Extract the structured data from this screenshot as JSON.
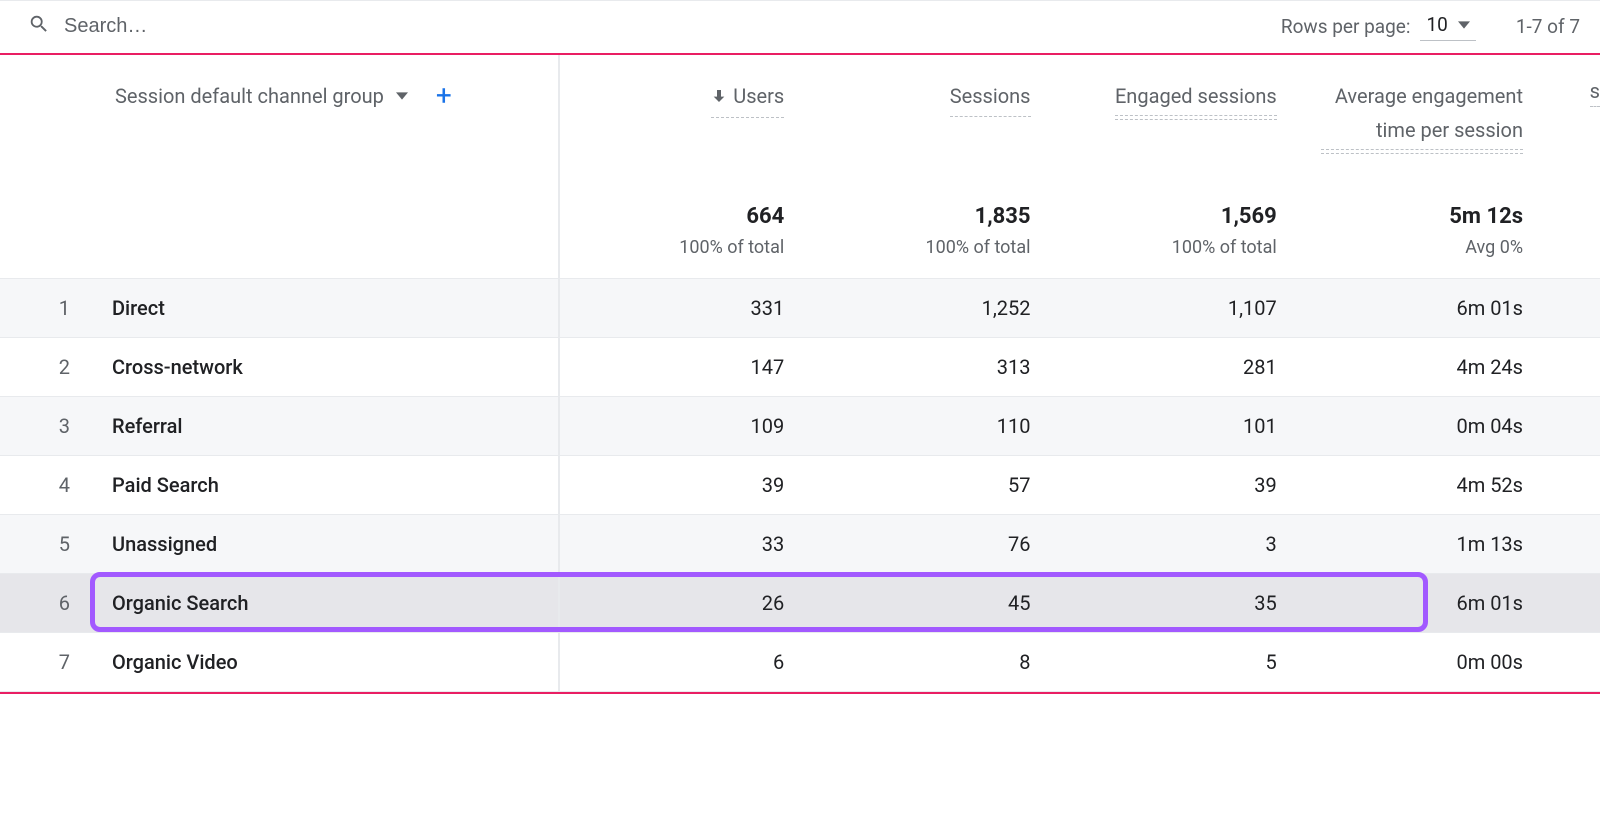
{
  "search": {
    "placeholder": "Search…"
  },
  "pager": {
    "rows_label": "Rows per page:",
    "rows_value": "10",
    "range": "1-7 of 7"
  },
  "dimension": {
    "label": "Session default channel group"
  },
  "columns": [
    {
      "label": "Users",
      "sorted": true,
      "total": "664",
      "sub": "100% of total"
    },
    {
      "label": "Sessions",
      "sorted": false,
      "total": "1,835",
      "sub": "100% of total"
    },
    {
      "label": "Engaged sessions",
      "sorted": false,
      "total": "1,569",
      "sub": "100% of total"
    },
    {
      "label": "Average engagement time per session",
      "sorted": false,
      "total": "5m 12s",
      "sub": "Avg 0%"
    }
  ],
  "extra_col_fragment": "s",
  "rows": [
    {
      "idx": "1",
      "name": "Direct",
      "v": [
        "331",
        "1,252",
        "1,107",
        "6m 01s"
      ]
    },
    {
      "idx": "2",
      "name": "Cross-network",
      "v": [
        "147",
        "313",
        "281",
        "4m 24s"
      ]
    },
    {
      "idx": "3",
      "name": "Referral",
      "v": [
        "109",
        "110",
        "101",
        "0m 04s"
      ]
    },
    {
      "idx": "4",
      "name": "Paid Search",
      "v": [
        "39",
        "57",
        "39",
        "4m 52s"
      ]
    },
    {
      "idx": "5",
      "name": "Unassigned",
      "v": [
        "33",
        "76",
        "3",
        "1m 13s"
      ]
    },
    {
      "idx": "6",
      "name": "Organic Search",
      "v": [
        "26",
        "45",
        "35",
        "6m 01s"
      ],
      "highlight": true
    },
    {
      "idx": "7",
      "name": "Organic Video",
      "v": [
        "6",
        "8",
        "5",
        "0m 00s"
      ]
    }
  ],
  "chart_data": {
    "type": "table",
    "title": "Session default channel group",
    "columns": [
      "Users",
      "Sessions",
      "Engaged sessions",
      "Average engagement time per session"
    ],
    "categories": [
      "Direct",
      "Cross-network",
      "Referral",
      "Paid Search",
      "Unassigned",
      "Organic Search",
      "Organic Video"
    ],
    "series": [
      {
        "name": "Users",
        "values": [
          331,
          147,
          109,
          39,
          33,
          26,
          6
        ]
      },
      {
        "name": "Sessions",
        "values": [
          1252,
          313,
          110,
          57,
          76,
          45,
          8
        ]
      },
      {
        "name": "Engaged sessions",
        "values": [
          1107,
          281,
          101,
          39,
          3,
          35,
          5
        ]
      },
      {
        "name": "Avg engagement time per session (sec)",
        "values": [
          361,
          264,
          4,
          292,
          73,
          361,
          0
        ]
      }
    ],
    "totals": {
      "Users": 664,
      "Sessions": 1835,
      "Engaged sessions": 1569,
      "Avg engagement time per session (sec)": 312
    }
  }
}
